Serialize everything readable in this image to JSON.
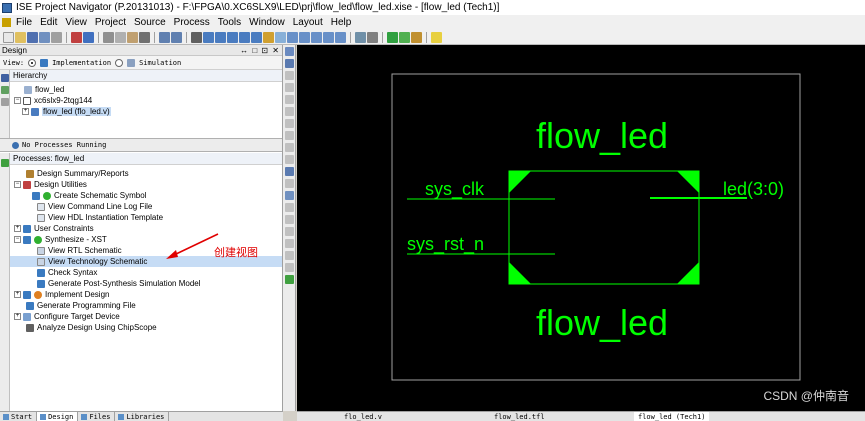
{
  "window": {
    "title": "ISE Project Navigator (P.20131013) - F:\\FPGA\\0.XC6SLX9\\LED\\prj\\flow_led\\flow_led.xise - [flow_led (Tech1)]"
  },
  "menu": {
    "items": [
      "File",
      "Edit",
      "View",
      "Project",
      "Source",
      "Process",
      "Tools",
      "Window",
      "Layout",
      "Help"
    ]
  },
  "design_panel": {
    "title": "Design",
    "controls": "↔ □ ⊡ ✕",
    "view_label": "View:",
    "view_implementation": "Implementation",
    "view_simulation": "Simulation",
    "hierarchy_label": "Hierarchy",
    "hierarchy": [
      {
        "label": "flow_led"
      },
      {
        "label": "xc6slx9-2tqg144"
      },
      {
        "label": "flow_led (flo_led.v)"
      }
    ],
    "status": "No Processes Running",
    "processes_label": "Processes: flow_led",
    "processes": [
      "Design Summary/Reports",
      "Design Utilities",
      "Create Schematic Symbol",
      "View Command Line Log File",
      "View HDL Instantiation Template",
      "User Constraints",
      "Synthesize - XST",
      "View RTL Schematic",
      "View Technology Schematic",
      "Check Syntax",
      "Generate Post-Synthesis Simulation Model",
      "Implement Design",
      "Generate Programming File",
      "Configure Target Device",
      "Analyze Design Using ChipScope"
    ]
  },
  "annotation": {
    "text": "创建视图",
    "color": "#e00000"
  },
  "bottom_tabs": [
    "Start",
    "Design",
    "Files",
    "Libraries"
  ],
  "doc_tabs": [
    "flo_led.v",
    "flow_led.tfl",
    "flow_led (Tech1)"
  ],
  "schematic": {
    "top_label": "flow_led",
    "bottom_label": "flow_led",
    "inputs": [
      "sys_clk",
      "sys_rst_n"
    ],
    "outputs": [
      "led(3:0)"
    ],
    "color": "#00ff00"
  },
  "watermark": "CSDN @仲南音"
}
